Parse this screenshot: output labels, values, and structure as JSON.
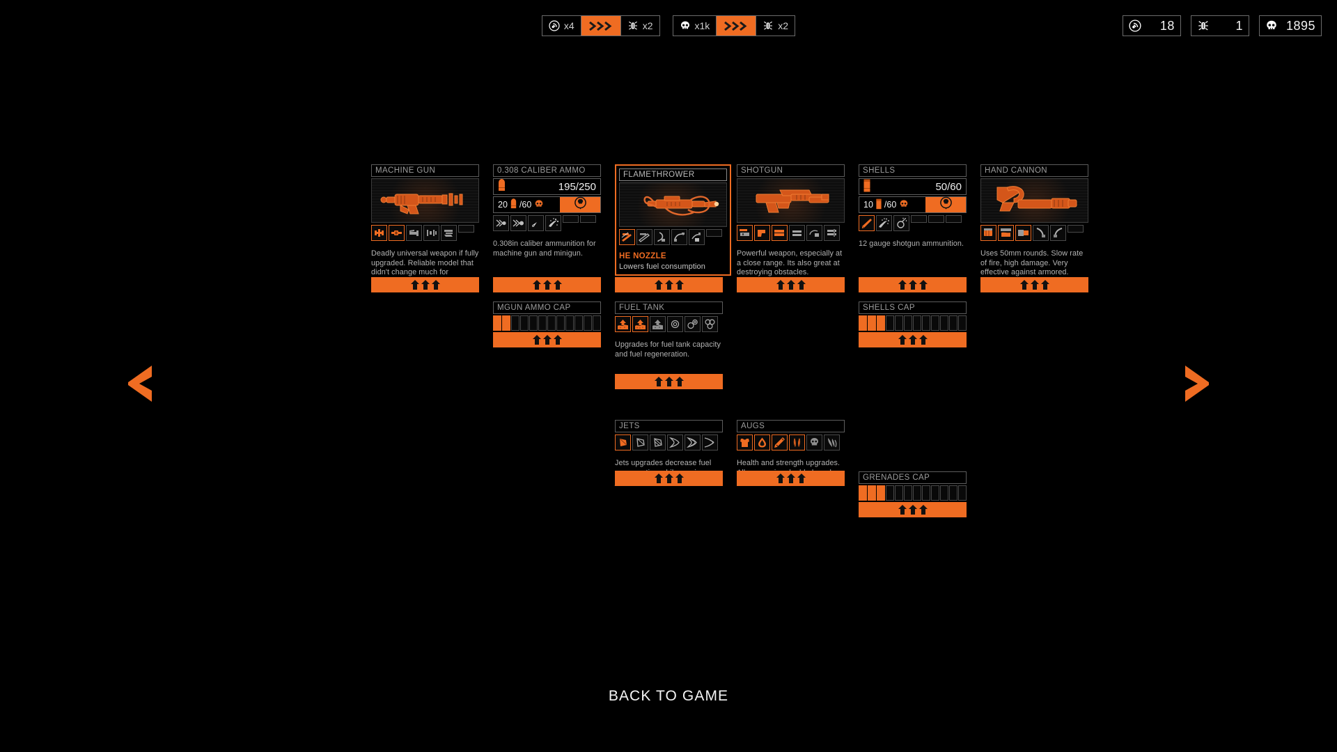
{
  "hud": {
    "combos": [
      {
        "left_icon": "sonar-icon",
        "left_label": "x4",
        "arrow_icon": "triple-chevron-icon",
        "right_icon": "bug-icon",
        "right_label": "x2"
      },
      {
        "left_icon": "skull-icon",
        "left_label": "x1k",
        "arrow_icon": "triple-chevron-icon",
        "right_icon": "bug-icon",
        "right_label": "x2"
      }
    ],
    "stats": [
      {
        "icon": "sonar-icon",
        "value": "18"
      },
      {
        "icon": "bug-icon",
        "value": "1"
      },
      {
        "icon": "skull-icon",
        "value": "1895"
      }
    ]
  },
  "nav": {
    "prev_icon": "chevron-left-icon",
    "next_icon": "chevron-right-icon"
  },
  "cards": {
    "machine_gun": {
      "title": "MACHINE GUN",
      "art_icon": "minigun-icon",
      "upgrades": [
        {
          "icon": "mgun-barrel-icon",
          "owned": true
        },
        {
          "icon": "mgun-receiver-icon",
          "owned": true
        },
        {
          "icon": "mgun-stock-icon",
          "owned": false
        },
        {
          "icon": "mgun-bolt-icon",
          "owned": false
        },
        {
          "icon": "mgun-frame-icon",
          "owned": false
        },
        {
          "icon": "empty-slot-icon",
          "owned": false,
          "blank": true
        }
      ],
      "desc": "Deadly universal weapon if fully upgraded. Reliable model that didn't change much for decades.",
      "upgrade_button": "triple-up-arrow-icon"
    },
    "ammo_308": {
      "title": "0.308 CALIBER AMMO",
      "ammo_icon": "bullet-icon",
      "ammo_count": "195/250",
      "reward_amount": "20",
      "reward_icon": "bullet-icon",
      "reward_cost": "/60",
      "reward_cost_icon": "skull-icon",
      "buy_icon": "skull-buy-icon",
      "upgrades": [
        {
          "icon": "bullet-speed-icon",
          "owned": false
        },
        {
          "icon": "bullet-speed2-icon",
          "owned": false
        },
        {
          "icon": "bullet-ap-icon",
          "owned": false
        },
        {
          "icon": "bullet-frag-icon",
          "owned": false
        },
        {
          "icon": "empty-slot-icon",
          "owned": false,
          "blank": true
        },
        {
          "icon": "empty-slot-icon",
          "owned": false,
          "blank": true
        }
      ],
      "desc": "0.308in caliber ammunition for machine gun and minigun.",
      "upgrade_button": "triple-up-arrow-icon"
    },
    "flamethrower": {
      "title": "FLAMETHROWER",
      "selected": true,
      "art_icon": "flamethrower-icon",
      "upgrades": [
        {
          "icon": "he-nozzle-icon",
          "owned": true
        },
        {
          "icon": "nozzle2-icon",
          "owned": false
        },
        {
          "icon": "hose-icon",
          "owned": false
        },
        {
          "icon": "valve-icon",
          "owned": false
        },
        {
          "icon": "tank-mount-icon",
          "owned": false
        },
        {
          "icon": "empty-slot-icon",
          "owned": false,
          "blank": true
        }
      ],
      "sub_title": "HE NOZZLE",
      "sub_text": "Lowers fuel consumption",
      "upgrade_button": "triple-up-arrow-icon"
    },
    "shotgun": {
      "title": "SHOTGUN",
      "art_icon": "shotgun-icon",
      "upgrades": [
        {
          "icon": "shotgun-receiver-icon",
          "owned": true
        },
        {
          "icon": "shotgun-grip-icon",
          "owned": true
        },
        {
          "icon": "shotgun-barrel-icon",
          "owned": true
        },
        {
          "icon": "shotgun-mag-icon",
          "owned": false
        },
        {
          "icon": "shotgun-choke-icon",
          "owned": false
        },
        {
          "icon": "shotgun-rail-icon",
          "owned": false
        }
      ],
      "desc": "Powerful weapon, especially at a close range. Its also great at destroying obstacles.",
      "upgrade_button": "triple-up-arrow-icon"
    },
    "shells": {
      "title": "SHELLS",
      "ammo_icon": "shell-icon",
      "ammo_count": "50/60",
      "reward_amount": "10",
      "reward_icon": "shell-icon",
      "reward_cost": "/60",
      "reward_cost_icon": "skull-icon",
      "buy_icon": "skull-buy-icon",
      "upgrades": [
        {
          "icon": "shell-slug-icon",
          "owned": true
        },
        {
          "icon": "shell-buck-icon",
          "owned": false
        },
        {
          "icon": "shell-explosive-icon",
          "owned": false
        },
        {
          "icon": "empty-slot-icon",
          "owned": false,
          "blank": true
        },
        {
          "icon": "empty-slot-icon",
          "owned": false,
          "blank": true
        },
        {
          "icon": "empty-slot-icon",
          "owned": false,
          "blank": true
        }
      ],
      "desc": "12 gauge shotgun ammunition.",
      "upgrade_button": "triple-up-arrow-icon"
    },
    "hand_cannon": {
      "title": "HAND CANNON",
      "art_icon": "handcannon-icon",
      "upgrades": [
        {
          "icon": "hc-cylinder-icon",
          "owned": true
        },
        {
          "icon": "hc-frame-icon",
          "owned": true
        },
        {
          "icon": "hc-barrel-icon",
          "owned": true
        },
        {
          "icon": "hc-grip-icon",
          "owned": false
        },
        {
          "icon": "hc-hammer-icon",
          "owned": false
        },
        {
          "icon": "empty-slot-icon",
          "owned": false,
          "blank": true
        }
      ],
      "desc": "Uses 50mm rounds. Slow rate of fire, high damage. Very effective against armored.",
      "upgrade_button": "triple-up-arrow-icon"
    },
    "mgun_ammo_cap": {
      "title": "MGUN AMMO CAP",
      "segments_total": 12,
      "segments_filled": 2,
      "upgrade_button": "triple-up-arrow-icon"
    },
    "fuel_tank": {
      "title": "FUEL TANK",
      "upgrades": [
        {
          "icon": "fuel-cap-icon",
          "owned": true
        },
        {
          "icon": "fuel-cap2-icon",
          "owned": true
        },
        {
          "icon": "fuel-cap3-icon",
          "owned": false
        },
        {
          "icon": "fuel-regen-icon",
          "owned": false
        },
        {
          "icon": "fuel-regen2-icon",
          "owned": false
        },
        {
          "icon": "fuel-regen3-icon",
          "owned": false
        }
      ],
      "desc": "Upgrades for fuel tank capacity and fuel regeneration.",
      "upgrade_button": "triple-up-arrow-icon"
    },
    "shells_cap": {
      "title": "SHELLS CAP",
      "segments_total": 12,
      "segments_filled": 3,
      "upgrade_button": "triple-up-arrow-icon"
    },
    "jets": {
      "title": "JETS",
      "upgrades": [
        {
          "icon": "jet-pack-icon",
          "owned": true
        },
        {
          "icon": "jet-pack2-icon",
          "owned": false
        },
        {
          "icon": "jet-pack3-icon",
          "owned": false
        },
        {
          "icon": "jet-thrust-icon",
          "owned": false
        },
        {
          "icon": "jet-thrust2-icon",
          "owned": false
        },
        {
          "icon": "jet-thrust3-icon",
          "owned": false
        }
      ],
      "desc": "Jets upgrades decrease fuel consumption while moving or jumping.",
      "upgrade_button": "triple-up-arrow-icon"
    },
    "augs": {
      "title": "AUGS",
      "upgrades": [
        {
          "icon": "armor-vest-icon",
          "owned": true
        },
        {
          "icon": "health-drop-icon",
          "owned": true
        },
        {
          "icon": "strength-arm-icon",
          "owned": true
        },
        {
          "icon": "dual-wield-icon",
          "owned": true
        },
        {
          "icon": "skull-aug-icon",
          "owned": false
        },
        {
          "icon": "claw-aug-icon",
          "owned": false
        }
      ],
      "desc": "Health and strength upgrades. Allow carrying double barrel machine gun and minigun.",
      "upgrade_button": "triple-up-arrow-icon"
    },
    "grenades_cap": {
      "title": "GRENADES CAP",
      "segments_total": 12,
      "segments_filled": 3,
      "upgrade_button": "triple-up-arrow-icon"
    }
  },
  "footer": {
    "back_label": "BACK TO GAME"
  },
  "colors": {
    "accent": "#ef6c22",
    "bg": "#000000",
    "border": "#5d5d5d",
    "text": "#b4b4b4"
  }
}
